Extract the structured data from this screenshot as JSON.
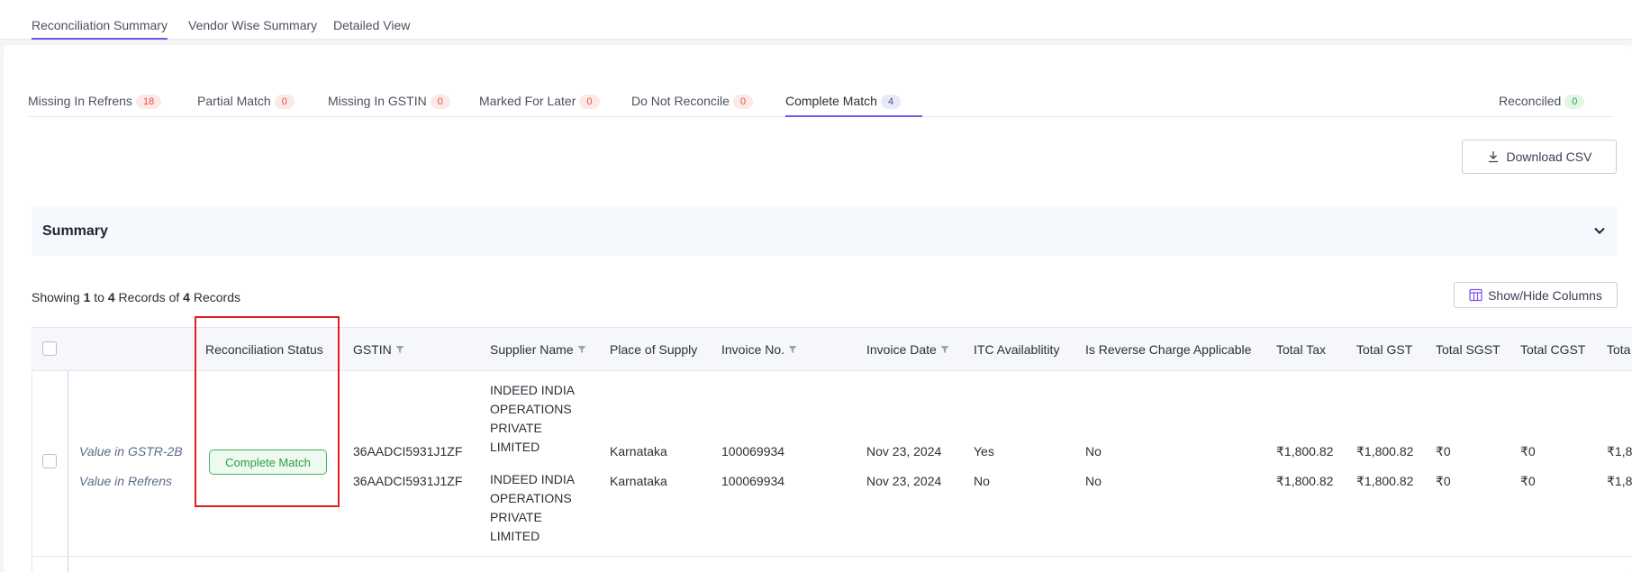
{
  "top_tabs": [
    {
      "label": "Reconciliation Summary",
      "active": true
    },
    {
      "label": "Vendor Wise Summary",
      "active": false
    },
    {
      "label": "Detailed View",
      "active": false
    }
  ],
  "status_tabs": [
    {
      "label": "Missing In Refrens",
      "count": "18",
      "color": "red"
    },
    {
      "label": "Partial Match",
      "count": "0",
      "color": "red"
    },
    {
      "label": "Missing In GSTIN",
      "count": "0",
      "color": "red"
    },
    {
      "label": "Marked For Later",
      "count": "0",
      "color": "red"
    },
    {
      "label": "Do Not Reconcile",
      "count": "0",
      "color": "red"
    },
    {
      "label": "Complete Match",
      "count": "4",
      "color": "blue",
      "active": true
    }
  ],
  "reconciled": {
    "label": "Reconciled",
    "count": "0"
  },
  "download_button": {
    "label": "Download CSV",
    "icon": "download-icon"
  },
  "summary": {
    "title": "Summary",
    "icon": "chevron-down-icon"
  },
  "showing": {
    "prefix": "Showing",
    "from": "1",
    "to_word": "to",
    "to": "4",
    "records_word": "Records",
    "of_word": "of",
    "total": "4",
    "records_word2": "Records"
  },
  "show_hide_button": {
    "label": "Show/Hide Columns",
    "icon": "columns-icon"
  },
  "table": {
    "headers": [
      "Reconciliation Status",
      "GSTIN",
      "Supplier Name",
      "Place of Supply",
      "Invoice No.",
      "Invoice Date",
      "ITC Availablitity",
      "Is Reverse Charge Applicable",
      "Total Tax",
      "Total GST",
      "Total SGST",
      "Total CGST",
      "Tota"
    ],
    "status_label": "Complete Match",
    "rows": [
      {
        "source": "Value in GSTR-2B",
        "gstin": "36AADCI5931J1ZF",
        "supplier": "INDEED INDIA OPERATIONS PRIVATE LIMITED",
        "place": "Karnataka",
        "invoice_no": "100069934",
        "invoice_date": "Nov 23, 2024",
        "itc": "Yes",
        "reverse_charge": "No",
        "total_tax": "₹1,800.82",
        "total_gst": "₹1,800.82",
        "total_sgst": "₹0",
        "total_cgst": "₹0",
        "last_col": "₹1,8"
      },
      {
        "source": "Value in Refrens",
        "gstin": "36AADCI5931J1ZF",
        "supplier": "INDEED INDIA OPERATIONS PRIVATE LIMITED",
        "place": "Karnataka",
        "invoice_no": "100069934",
        "invoice_date": "Nov 23, 2024",
        "itc": "No",
        "reverse_charge": "No",
        "total_tax": "₹1,800.82",
        "total_gst": "₹1,800.82",
        "total_sgst": "₹0",
        "total_cgst": "₹0",
        "last_col": "₹1,8"
      }
    ]
  },
  "colors": {
    "accent": "#7b4ff0",
    "highlight": "#e02020",
    "success": "#2f9e44",
    "danger": "#e0533f"
  }
}
